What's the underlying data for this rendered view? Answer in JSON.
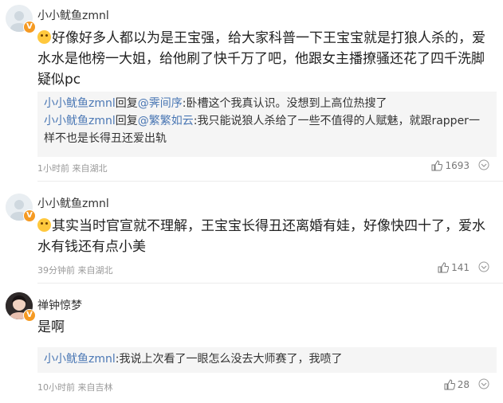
{
  "comments": [
    {
      "username": "小小鱿鱼zmnl",
      "text": "好像好多人都以为是王宝强，给大家科普一下王宝宝就是打狼人杀的，爱水水是他榜一大姐，给他刷了快千万了吧，他跟女主播撩骚还花了四千洗脚疑似pc",
      "replies": [
        {
          "author": "小小鱿鱼zmnl",
          "reply_word": "回复",
          "mention": "@霁间序",
          "body": ":卧槽这个我真认识。没想到上高位热搜了"
        },
        {
          "author": "小小鱿鱼zmnl",
          "reply_word": "回复",
          "mention": "@繁繁如云",
          "body": ":我只能说狼人杀给了一些不值得的人赋魅，就跟rapper一样不也是长得丑还爱出轨"
        }
      ],
      "time": "1小时前",
      "location": "来自湖北",
      "likes": "1693"
    },
    {
      "username": "小小鱿鱼zmnl",
      "text": "其实当时官宣就不理解，王宝宝长得丑还离婚有娃，好像快四十了，爱水水有钱还有点小美",
      "replies": [],
      "time": "39分钟前",
      "location": "来自湖北",
      "likes": "141"
    },
    {
      "username": "禅钟惊梦",
      "text": "是啊",
      "replies": [
        {
          "author": "小小鱿鱼zmnl",
          "reply_word": "",
          "mention": "",
          "body": ":我说上次看了一眼怎么没去大师赛了，我喷了"
        }
      ],
      "time": "10小时前",
      "location": "来自吉林",
      "likes": "28"
    }
  ],
  "icons": {
    "like": "thumbs-up-icon",
    "more": "chevron-down-icon",
    "badge": "verified-badge-icon"
  },
  "colors": {
    "link": "#4a77b4",
    "badge": "#f59a23",
    "reply_bg": "#f5f5f5"
  }
}
